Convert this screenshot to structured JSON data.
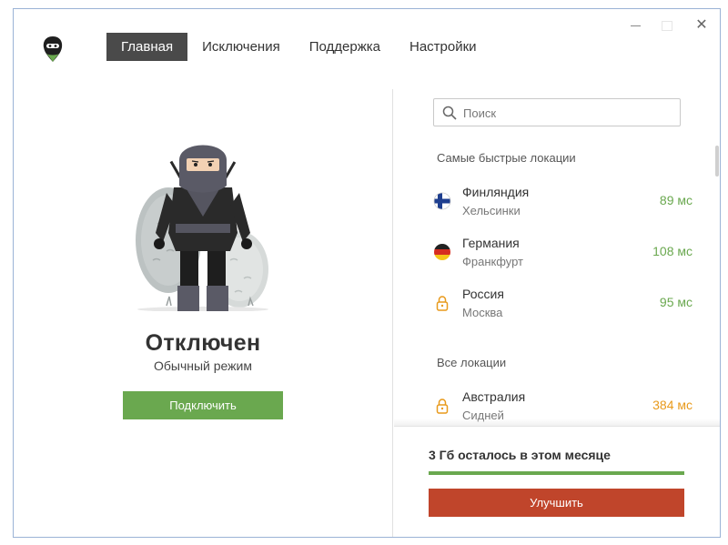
{
  "window": {
    "controls": {
      "minimize_icon": "minimize-icon",
      "maximize_icon": "maximize-icon",
      "close_label": "✕"
    }
  },
  "header": {
    "logo_icon": "ninja-logo-icon",
    "tabs": [
      {
        "label": "Главная",
        "active": true
      },
      {
        "label": "Исключения",
        "active": false
      },
      {
        "label": "Поддержка",
        "active": false
      },
      {
        "label": "Настройки",
        "active": false
      }
    ]
  },
  "left": {
    "illustration": "ninja-illustration",
    "status_title": "Отключен",
    "status_subtitle": "Обычный режим",
    "connect_label": "Подключить"
  },
  "right": {
    "search": {
      "placeholder": "Поиск",
      "value": ""
    },
    "fastest_title": "Самые быстрые локации",
    "fastest": [
      {
        "country": "Финляндия",
        "city": "Хельсинки",
        "ping": "89 мс",
        "icon": "finland-flag-icon",
        "ping_color": "#6aa84f"
      },
      {
        "country": "Германия",
        "city": "Франкфурт",
        "ping": "108 мс",
        "icon": "germany-flag-icon",
        "ping_color": "#6aa84f"
      },
      {
        "country": "Россия",
        "city": "Москва",
        "ping": "95 мс",
        "icon": "lock-icon",
        "ping_color": "#6aa84f"
      }
    ],
    "all_title": "Все локации",
    "all": [
      {
        "country": "Австралия",
        "city": "Сидней",
        "ping": "384 мс",
        "icon": "lock-icon",
        "ping_color": "#e89a1c"
      }
    ]
  },
  "footer": {
    "quota_text": "3 Гб осталось в этом месяце",
    "quota_fraction": 1.0,
    "upgrade_label": "Улучшить"
  },
  "colors": {
    "accent_green": "#6aa84f",
    "upgrade_red": "#c0452b",
    "active_tab": "#4a4a4a",
    "warning_orange": "#e89a1c"
  }
}
